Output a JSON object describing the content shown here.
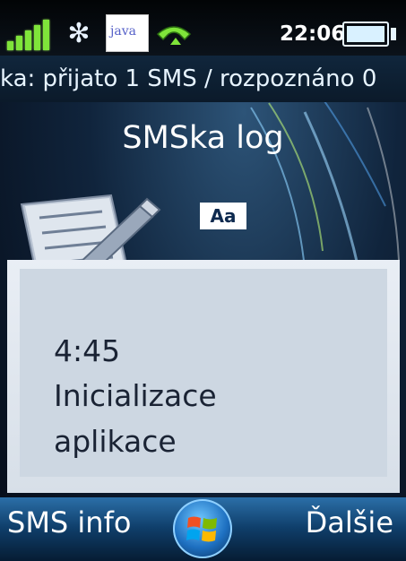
{
  "status_bar": {
    "icons": [
      "signal-strength-icon",
      "bluetooth-icon",
      "java-app-icon",
      "phone-call-icon",
      "battery-icon"
    ],
    "java_label": "java",
    "time": "22:06",
    "signal_level": 1.0,
    "battery_level": 1.0
  },
  "ticker": {
    "text": "ka: přijato 1 SMS  /  rozpoznáno 0"
  },
  "app": {
    "title": "SMSka log",
    "font_badge": "Aa",
    "icon": "notepad-pencil-icon"
  },
  "log": {
    "time": "4:45",
    "message_line_1": "Inicializace",
    "message_line_2": "aplikace"
  },
  "softkeys": {
    "left": "SMS info",
    "center_icon": "windows-start-icon",
    "right": "Ďalšie"
  },
  "colors": {
    "signal": "#7fe43a",
    "softkey_bar": "#0f3e6a",
    "panel": "#d7dfe8",
    "text_dark": "#1a2334"
  }
}
